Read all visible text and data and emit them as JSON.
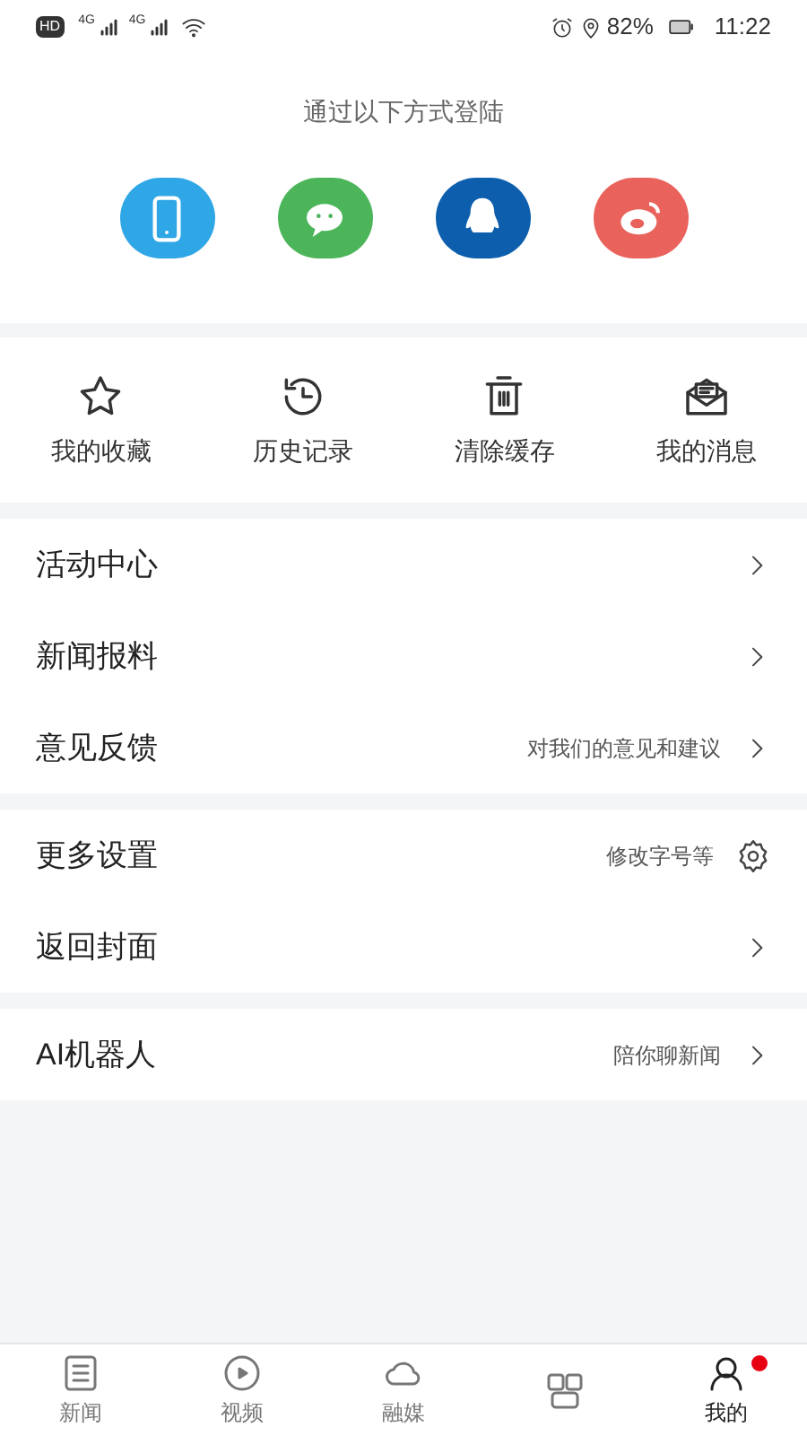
{
  "status_bar": {
    "hd": "HD",
    "signals": [
      "4G",
      "4G"
    ],
    "battery": "82%",
    "time": "11:22"
  },
  "login": {
    "title": "通过以下方式登陆",
    "methods": [
      {
        "kind": "phone",
        "color": "#2fa6e6"
      },
      {
        "kind": "wechat",
        "color": "#4cb55a"
      },
      {
        "kind": "qq",
        "color": "#0d5fae"
      },
      {
        "kind": "weibo",
        "color": "#e9625c"
      }
    ]
  },
  "shortcuts": [
    {
      "kind": "star",
      "label": "我的收藏"
    },
    {
      "kind": "history",
      "label": "历史记录"
    },
    {
      "kind": "trash",
      "label": "清除缓存"
    },
    {
      "kind": "mail",
      "label": "我的消息"
    }
  ],
  "menu_groups": [
    [
      {
        "label": "活动中心",
        "kind": "chevron"
      },
      {
        "label": "新闻报料",
        "kind": "chevron"
      },
      {
        "label": "意见反馈",
        "hint": "对我们的意见和建议",
        "kind": "chevron"
      }
    ],
    [
      {
        "label": "更多设置",
        "hint": "修改字号等",
        "kind": "gear"
      },
      {
        "label": "返回封面",
        "kind": "chevron"
      }
    ],
    [
      {
        "label": "AI机器人",
        "hint": "陪你聊新闻",
        "kind": "chevron"
      }
    ]
  ],
  "tab_bar": [
    {
      "kind": "news",
      "label": "新闻",
      "selected": false
    },
    {
      "kind": "video",
      "label": "视频",
      "selected": false
    },
    {
      "kind": "cloud",
      "label": "融媒",
      "selected": false
    },
    {
      "kind": "squares",
      "selected": false
    },
    {
      "kind": "person",
      "label": "我的",
      "selected": true,
      "badge": true
    }
  ]
}
